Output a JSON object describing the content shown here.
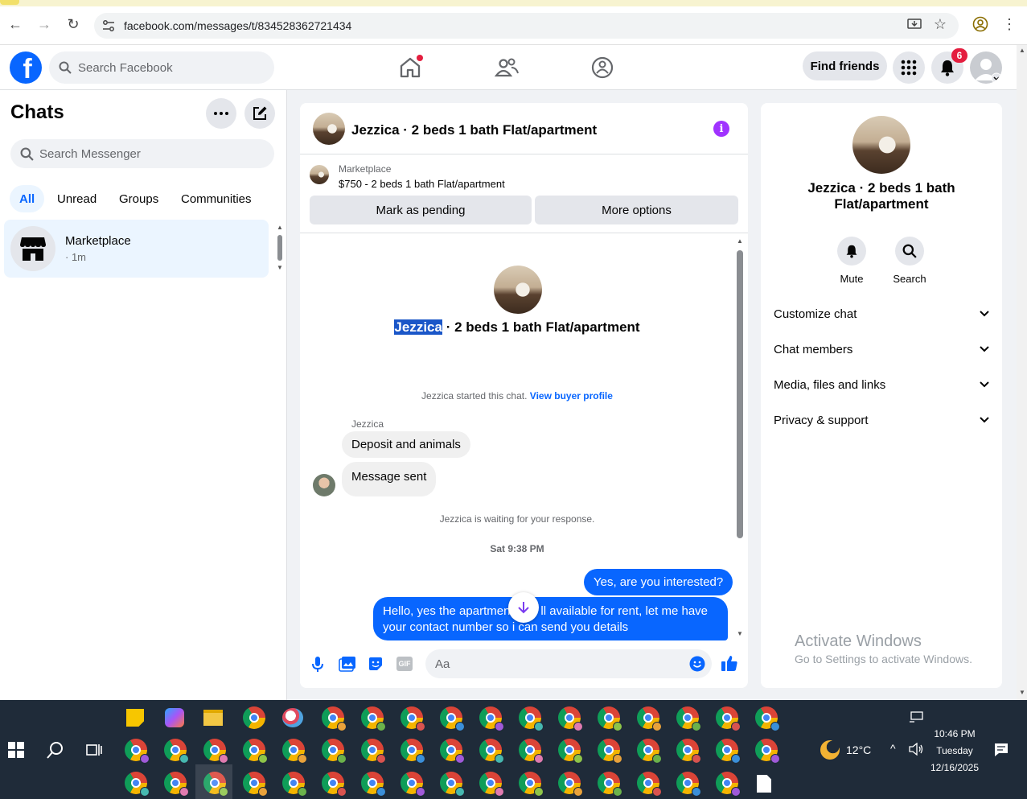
{
  "browser": {
    "url": "facebook.com/messages/t/834528362721434"
  },
  "header": {
    "search_placeholder": "Search Facebook",
    "find_friends_label": "Find friends",
    "notification_count": "6"
  },
  "left": {
    "title": "Chats",
    "search_placeholder": "Search Messenger",
    "tabs": [
      "All",
      "Unread",
      "Groups",
      "Communities"
    ],
    "chat": {
      "name": "Marketplace",
      "time": "· 1m"
    }
  },
  "conversation": {
    "title": "Jezzica · 2 beds 1 bath Flat/apartment",
    "listing_source": "Marketplace",
    "listing_price": "$750 - 2 beds 1 bath Flat/apartment",
    "mark_pending_label": "Mark as pending",
    "more_options_label": "More options",
    "intro_name_highlight": "Jezzica",
    "intro_name_rest": " · 2 beds 1 bath Flat/apartment",
    "started_text": "Jezzica started this chat.",
    "view_buyer_label": "View buyer profile",
    "sender_name": "Jezzica",
    "msg_in_1": "Deposit and animals",
    "msg_in_2": "Message sent",
    "waiting_text": "Jezzica is waiting for your response.",
    "timestamp": "Sat 9:38 PM",
    "msg_out_1": "Yes, are you interested?",
    "msg_out_2_a": "Hello, yes the apartmen",
    "msg_out_2_b": "ll available for rent, let me have",
    "msg_out_2_c": "your contact number so i can send you details",
    "composer_placeholder": "Aa"
  },
  "right": {
    "name": "Jezzica · 2 beds 1 bath Flat/apartment",
    "mute_label": "Mute",
    "search_label": "Search",
    "rows": [
      "Customize chat",
      "Chat members",
      "Media, files and links",
      "Privacy & support"
    ]
  },
  "watermark": {
    "line1": "Activate Windows",
    "line2": "Go to Settings to activate Windows."
  },
  "taskbar": {
    "weather": "12°C",
    "time": "10:46 PM",
    "day": "Tuesday",
    "date": "12/16/2025"
  }
}
